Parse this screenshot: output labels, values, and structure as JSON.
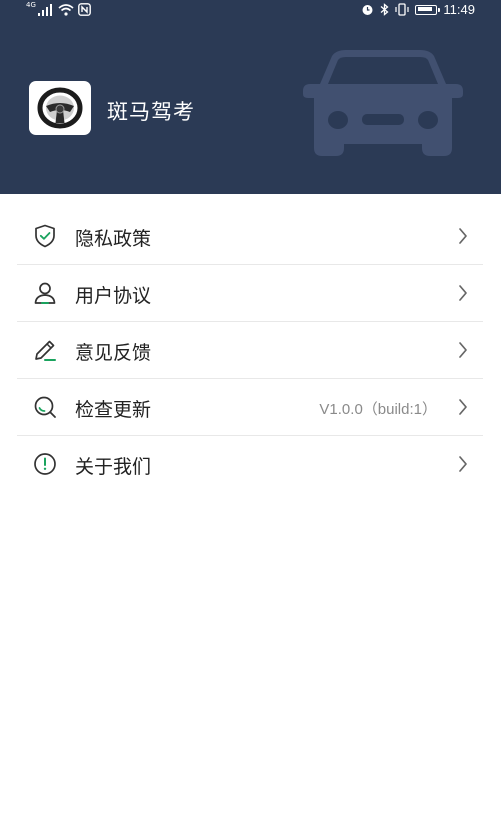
{
  "status_bar": {
    "signal_label": "4G",
    "time": "11:49",
    "icons": [
      "signal-icon",
      "wifi-icon",
      "nfc-icon",
      "alarm-icon",
      "bluetooth-icon",
      "vibrate-icon",
      "battery-icon"
    ],
    "battery_level": 0.9
  },
  "header": {
    "app_name": "斑马驾考",
    "app_icon": "steering-wheel-icon",
    "background_icon": "car-icon",
    "background_color": "#2b3a55"
  },
  "menu": {
    "items": [
      {
        "label": "隐私政策",
        "icon": "shield-check-icon",
        "value": ""
      },
      {
        "label": "用户协议",
        "icon": "user-icon",
        "value": ""
      },
      {
        "label": "意见反馈",
        "icon": "pencil-icon",
        "value": ""
      },
      {
        "label": "检查更新",
        "icon": "search-icon",
        "value": "V1.0.0（build:1）"
      },
      {
        "label": "关于我们",
        "icon": "info-exclamation-icon",
        "value": ""
      }
    ]
  },
  "colors": {
    "accent": "#1aa35e",
    "icon_stroke": "#333333",
    "chevron": "#666666"
  }
}
